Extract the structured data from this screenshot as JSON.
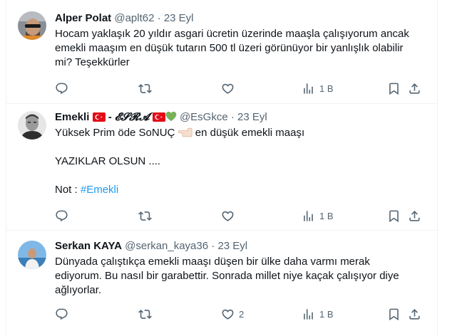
{
  "tweets": [
    {
      "name": "Alper Polat",
      "handle": "@aplt62",
      "dot": "·",
      "date": "23 Eyl",
      "lines": [
        "Hocam yaklaşık 20 yıldır asgari ücretin üzerinde maaşla çalışıyorum ancak",
        "emekli maaşım en düşük tutarın 500 tl üzeri görünüyor bir yanlışlık olabilir",
        "mi? Teşekkürler"
      ],
      "views": "1 B",
      "likes": ""
    },
    {
      "name_prefix": "Emekli",
      "name_sep": " - ",
      "name_styled": "𝓔𝓢𝓡𝓐",
      "handle": "@EsGkce",
      "dot": "·",
      "date": "23 Eyl",
      "line1_a": "Yüksek Prim öde SoNUÇ",
      "line1_b": "en düşük emekli maaşı",
      "line2": "YAZIKLAR OLSUN ....",
      "line3_label": "Not : ",
      "hashtag": "#Emekli",
      "views": "1 B",
      "likes": ""
    },
    {
      "name": "Serkan KAYA",
      "handle": "@serkan_kaya36",
      "dot": "·",
      "date": "23 Eyl",
      "lines": [
        "Dünyada çalıştıkça emekli maaşı düşen bir ülke daha varmı merak",
        "ediyorum. Bu nasıl bir garabettir. Sonrada millet niye kaçak çalışıyor diye",
        "ağlıyorlar."
      ],
      "views": "1 B",
      "likes": "2"
    }
  ],
  "icons": {
    "reply": "reply-icon",
    "retweet": "retweet-icon",
    "like": "like-icon",
    "views": "views-icon",
    "bookmark": "bookmark-icon",
    "share": "share-icon"
  },
  "colors": {
    "text": "#0f1419",
    "secondary": "#536471",
    "link": "#1d9bf0",
    "border": "#eff3f4",
    "flag_red": "#e30a17",
    "heart_green": "#78b159"
  }
}
